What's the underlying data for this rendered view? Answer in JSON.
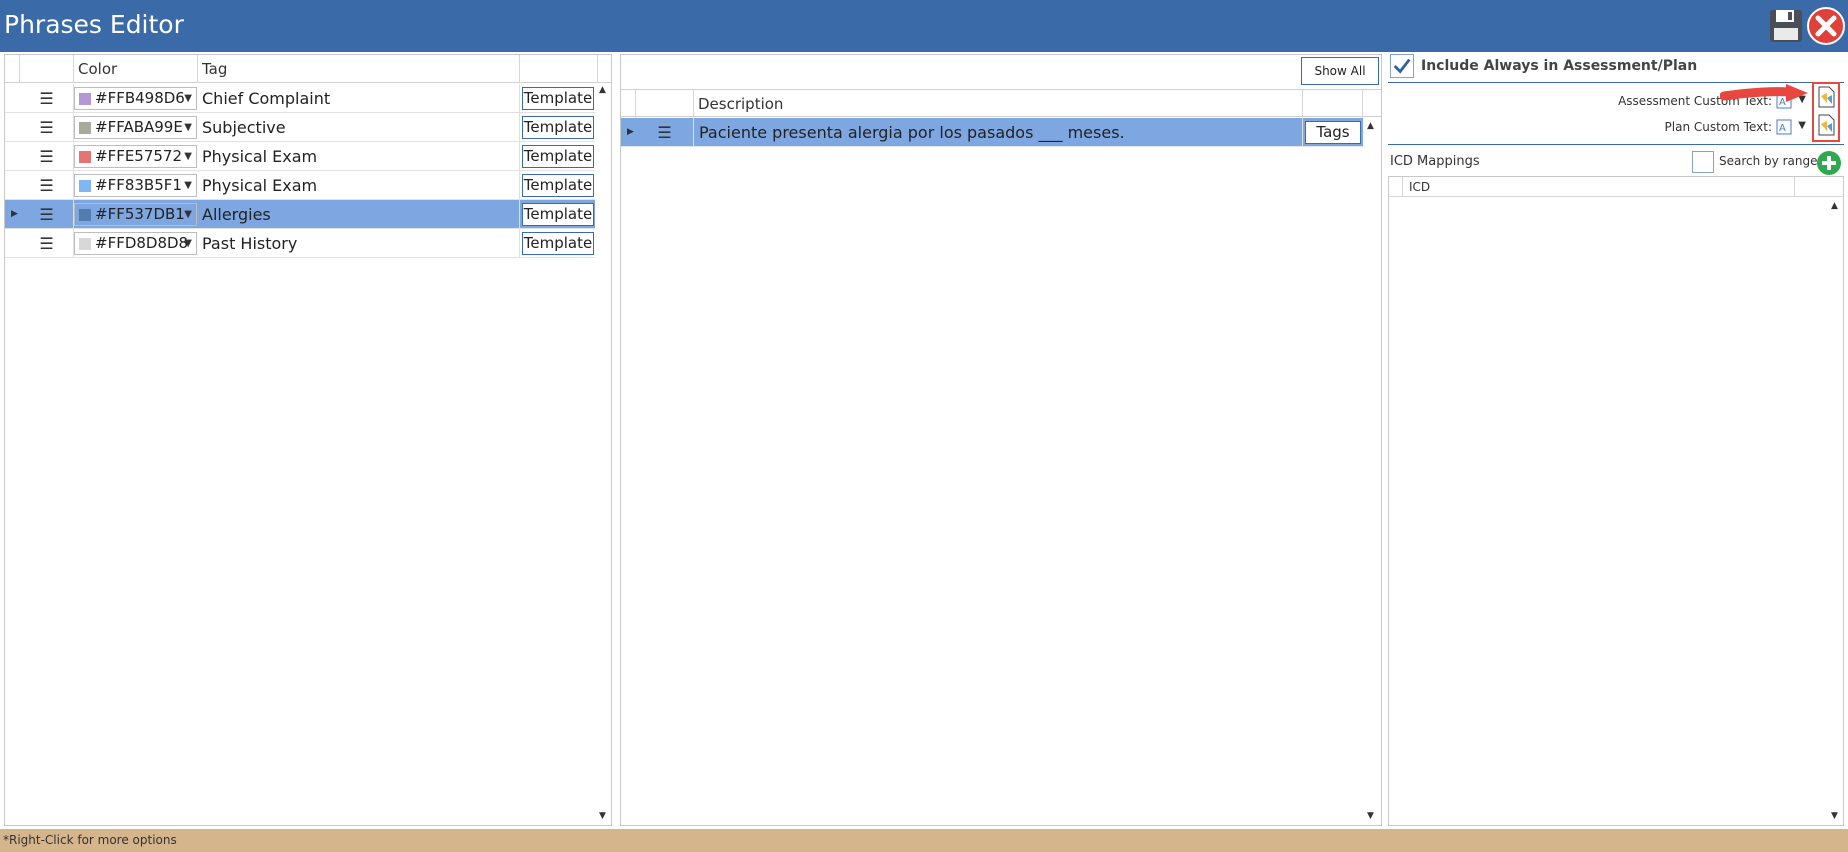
{
  "window": {
    "title": "Phrases Editor"
  },
  "left_grid": {
    "headers": {
      "color": "Color",
      "tag": "Tag"
    },
    "rows": [
      {
        "color_value": "#FFB498D6",
        "swatch": "#B498D6",
        "tag": "Chief Complaint",
        "button": "Template",
        "selected": false
      },
      {
        "color_value": "#FFABA99E",
        "swatch": "#ABA99E",
        "tag": "Subjective",
        "button": "Template",
        "selected": false
      },
      {
        "color_value": "#FFE57572",
        "swatch": "#E57572",
        "tag": "Physical Exam",
        "button": "Template",
        "selected": false
      },
      {
        "color_value": "#FF83B5F1",
        "swatch": "#83B5F1",
        "tag": "Physical Exam",
        "button": "Template",
        "selected": false
      },
      {
        "color_value": "#FF537DB1",
        "swatch": "#537DB1",
        "tag": "Allergies",
        "button": "Template",
        "selected": true
      },
      {
        "color_value": "#FFD8D8D8",
        "swatch": "#D8D8D8",
        "tag": "Past History",
        "button": "Template",
        "selected": false
      }
    ]
  },
  "middle_grid": {
    "show_all_label": "Show All",
    "headers": {
      "description": "Description"
    },
    "rows": [
      {
        "description": "Paciente presenta alergia por los pasados ___ meses.",
        "button": "Tags",
        "selected": true
      }
    ]
  },
  "right_panel": {
    "include_always_label": "Include Always in Assessment/Plan",
    "include_always_checked": true,
    "assessment_custom_text_label": "Assessment Custom Text:",
    "plan_custom_text_label": "Plan Custom Text:",
    "icd_mappings_label": "ICD Mappings",
    "search_by_range_label": "Search by range",
    "search_by_range_checked": false,
    "icd_header": "ICD"
  },
  "status_bar": {
    "text": "*Right-Click for more options"
  },
  "colors": {
    "titlebar": "#3a6aa8",
    "selected_row": "#7ea7e1",
    "status_bar": "#d4b58c",
    "add_button": "#2fa84f",
    "close_button": "#e0403a",
    "annotation_red": "#e8473f"
  },
  "icons": [
    "save-icon",
    "close-icon",
    "drag-handle-icon",
    "dropdown-arrow-icon",
    "document-icon",
    "add-icon",
    "check-icon"
  ]
}
